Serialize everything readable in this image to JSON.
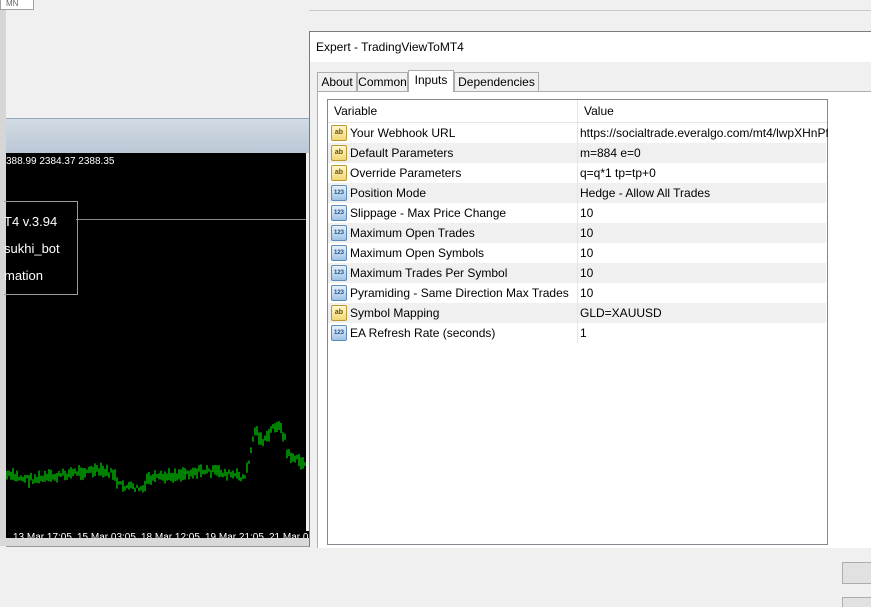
{
  "top_tab": {
    "label": "MN"
  },
  "chart": {
    "ohlc": "388.99 2384.37 2388.35",
    "info": {
      "line1": "T4 v.3.94",
      "line2": "sukhi_bot",
      "line3": "mation"
    },
    "time_labels": [
      "13 Mar 17:05",
      "15 Mar 03:05",
      "18 Mar 12:05",
      "19 Mar 21:05",
      "21 Mar 0"
    ],
    "price_color": "#00ff00"
  },
  "dialog": {
    "title": "Expert - TradingViewToMT4",
    "tabs": [
      "About",
      "Common",
      "Inputs",
      "Dependencies"
    ],
    "active_tab": "Inputs",
    "columns": {
      "variable": "Variable",
      "value": "Value"
    },
    "rows": [
      {
        "icon": "ab",
        "variable": "Your Webhook URL",
        "value": "https://socialtrade.everalgo.com/mt4/lwpXHnPf..."
      },
      {
        "icon": "ab",
        "variable": "Default Parameters",
        "value": "m=884 e=0"
      },
      {
        "icon": "ab",
        "variable": "Override Parameters",
        "value": "q=q*1 tp=tp+0"
      },
      {
        "icon": "123",
        "variable": "Position Mode",
        "value": "Hedge - Allow All Trades"
      },
      {
        "icon": "123",
        "variable": "Slippage - Max Price Change",
        "value": "10"
      },
      {
        "icon": "123",
        "variable": "Maximum Open Trades",
        "value": "10"
      },
      {
        "icon": "123",
        "variable": "Maximum Open Symbols",
        "value": "10"
      },
      {
        "icon": "123",
        "variable": "Maximum Trades Per Symbol",
        "value": "10"
      },
      {
        "icon": "123",
        "variable": "Pyramiding - Same Direction Max Trades",
        "value": "10"
      },
      {
        "icon": "ab",
        "variable": "Symbol Mapping",
        "value": "GLD=XAUUSD"
      },
      {
        "icon": "123",
        "variable": "EA Refresh Rate (seconds)",
        "value": "1"
      }
    ]
  }
}
